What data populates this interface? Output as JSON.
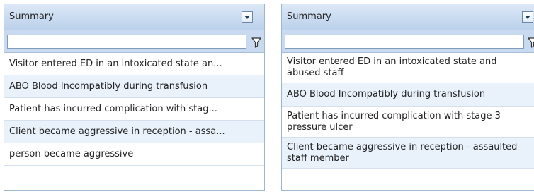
{
  "panels": [
    {
      "header": {
        "title": "Summary",
        "dropdown_icon": "chevron-down-icon"
      },
      "filter": {
        "value": "",
        "icon": "filter-icon"
      },
      "rows": [
        "Visitor entered ED in an intoxicated state an...",
        "ABO Blood Incompatibly during transfusion",
        "Patient has incurred complication with stag...",
        "Client became aggressive in reception - assa...",
        "person became aggressive"
      ]
    },
    {
      "header": {
        "title": "Summary",
        "dropdown_icon": "chevron-down-icon"
      },
      "filter": {
        "value": "",
        "icon": "filter-icon"
      },
      "rows": [
        "Visitor entered ED in an intoxicated state and abused staff",
        "ABO Blood Incompatibly during transfusion",
        "Patient has incurred complication with stage 3 pressure ulcer",
        "Client became aggressive in reception - assaulted staff member"
      ]
    }
  ],
  "colors": {
    "header_gradient_top": "#dce8f6",
    "header_gradient_bottom": "#bcd1eb",
    "filter_row": "#c9daf0",
    "row_alt": "#e9f1fb",
    "border": "#9fb6d1"
  }
}
